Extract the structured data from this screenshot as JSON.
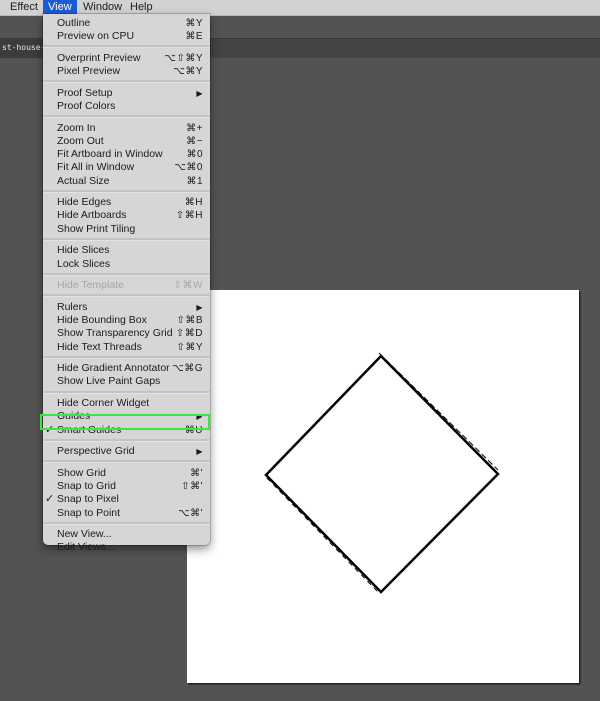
{
  "menubar": {
    "items": [
      {
        "label": "Effect"
      },
      {
        "label": "View",
        "active": true
      },
      {
        "label": "Window"
      },
      {
        "label": "Help"
      }
    ]
  },
  "document": {
    "tab_title": "st-house-lo"
  },
  "view_menu": {
    "groups": [
      [
        {
          "label": "Outline",
          "shortcut": "⌘Y"
        },
        {
          "label": "Preview on CPU",
          "shortcut": "⌘E"
        }
      ],
      [
        {
          "label": "Overprint Preview",
          "shortcut": "⌥⇧⌘Y"
        },
        {
          "label": "Pixel Preview",
          "shortcut": "⌥⌘Y"
        }
      ],
      [
        {
          "label": "Proof Setup",
          "shortcut": "▶",
          "submenu": true
        },
        {
          "label": "Proof Colors",
          "shortcut": ""
        }
      ],
      [
        {
          "label": "Zoom In",
          "shortcut": "⌘+"
        },
        {
          "label": "Zoom Out",
          "shortcut": "⌘−"
        },
        {
          "label": "Fit Artboard in Window",
          "shortcut": "⌘0"
        },
        {
          "label": "Fit All in Window",
          "shortcut": "⌥⌘0"
        },
        {
          "label": "Actual Size",
          "shortcut": "⌘1"
        }
      ],
      [
        {
          "label": "Hide Edges",
          "shortcut": "⌘H"
        },
        {
          "label": "Hide Artboards",
          "shortcut": "⇧⌘H"
        },
        {
          "label": "Show Print Tiling",
          "shortcut": ""
        }
      ],
      [
        {
          "label": "Hide Slices",
          "shortcut": ""
        },
        {
          "label": "Lock Slices",
          "shortcut": ""
        }
      ],
      [
        {
          "label": "Hide Template",
          "shortcut": "⇧⌘W",
          "disabled": true
        }
      ],
      [
        {
          "label": "Rulers",
          "shortcut": "▶",
          "submenu": true
        },
        {
          "label": "Hide Bounding Box",
          "shortcut": "⇧⌘B"
        },
        {
          "label": "Show Transparency Grid",
          "shortcut": "⇧⌘D"
        },
        {
          "label": "Hide Text Threads",
          "shortcut": "⇧⌘Y"
        }
      ],
      [
        {
          "label": "Hide Gradient Annotator",
          "shortcut": "⌥⌘G"
        },
        {
          "label": "Show Live Paint Gaps",
          "shortcut": ""
        }
      ],
      [
        {
          "label": "Hide Corner Widget",
          "shortcut": ""
        },
        {
          "label": "Guides",
          "shortcut": "▶",
          "submenu": true
        },
        {
          "label": "Smart Guides",
          "shortcut": "⌘U",
          "checked": true,
          "highlighted": true
        }
      ],
      [
        {
          "label": "Perspective Grid",
          "shortcut": "▶",
          "submenu": true
        }
      ],
      [
        {
          "label": "Show Grid",
          "shortcut": "⌘'"
        },
        {
          "label": "Snap to Grid",
          "shortcut": "⇧⌘'"
        },
        {
          "label": "Snap to Pixel",
          "shortcut": "",
          "checked": true
        },
        {
          "label": "Snap to Point",
          "shortcut": "⌥⌘'"
        }
      ],
      [
        {
          "label": "New View...",
          "shortcut": ""
        },
        {
          "label": "Edit Views...",
          "shortcut": ""
        }
      ]
    ],
    "check_glyph": "✓"
  },
  "colors": {
    "menu_active": "#1d5bd6",
    "highlight_outline": "#39e83b",
    "canvas_bg": "#535353",
    "artboard": "#ffffff",
    "shape_stroke": "#000000"
  }
}
